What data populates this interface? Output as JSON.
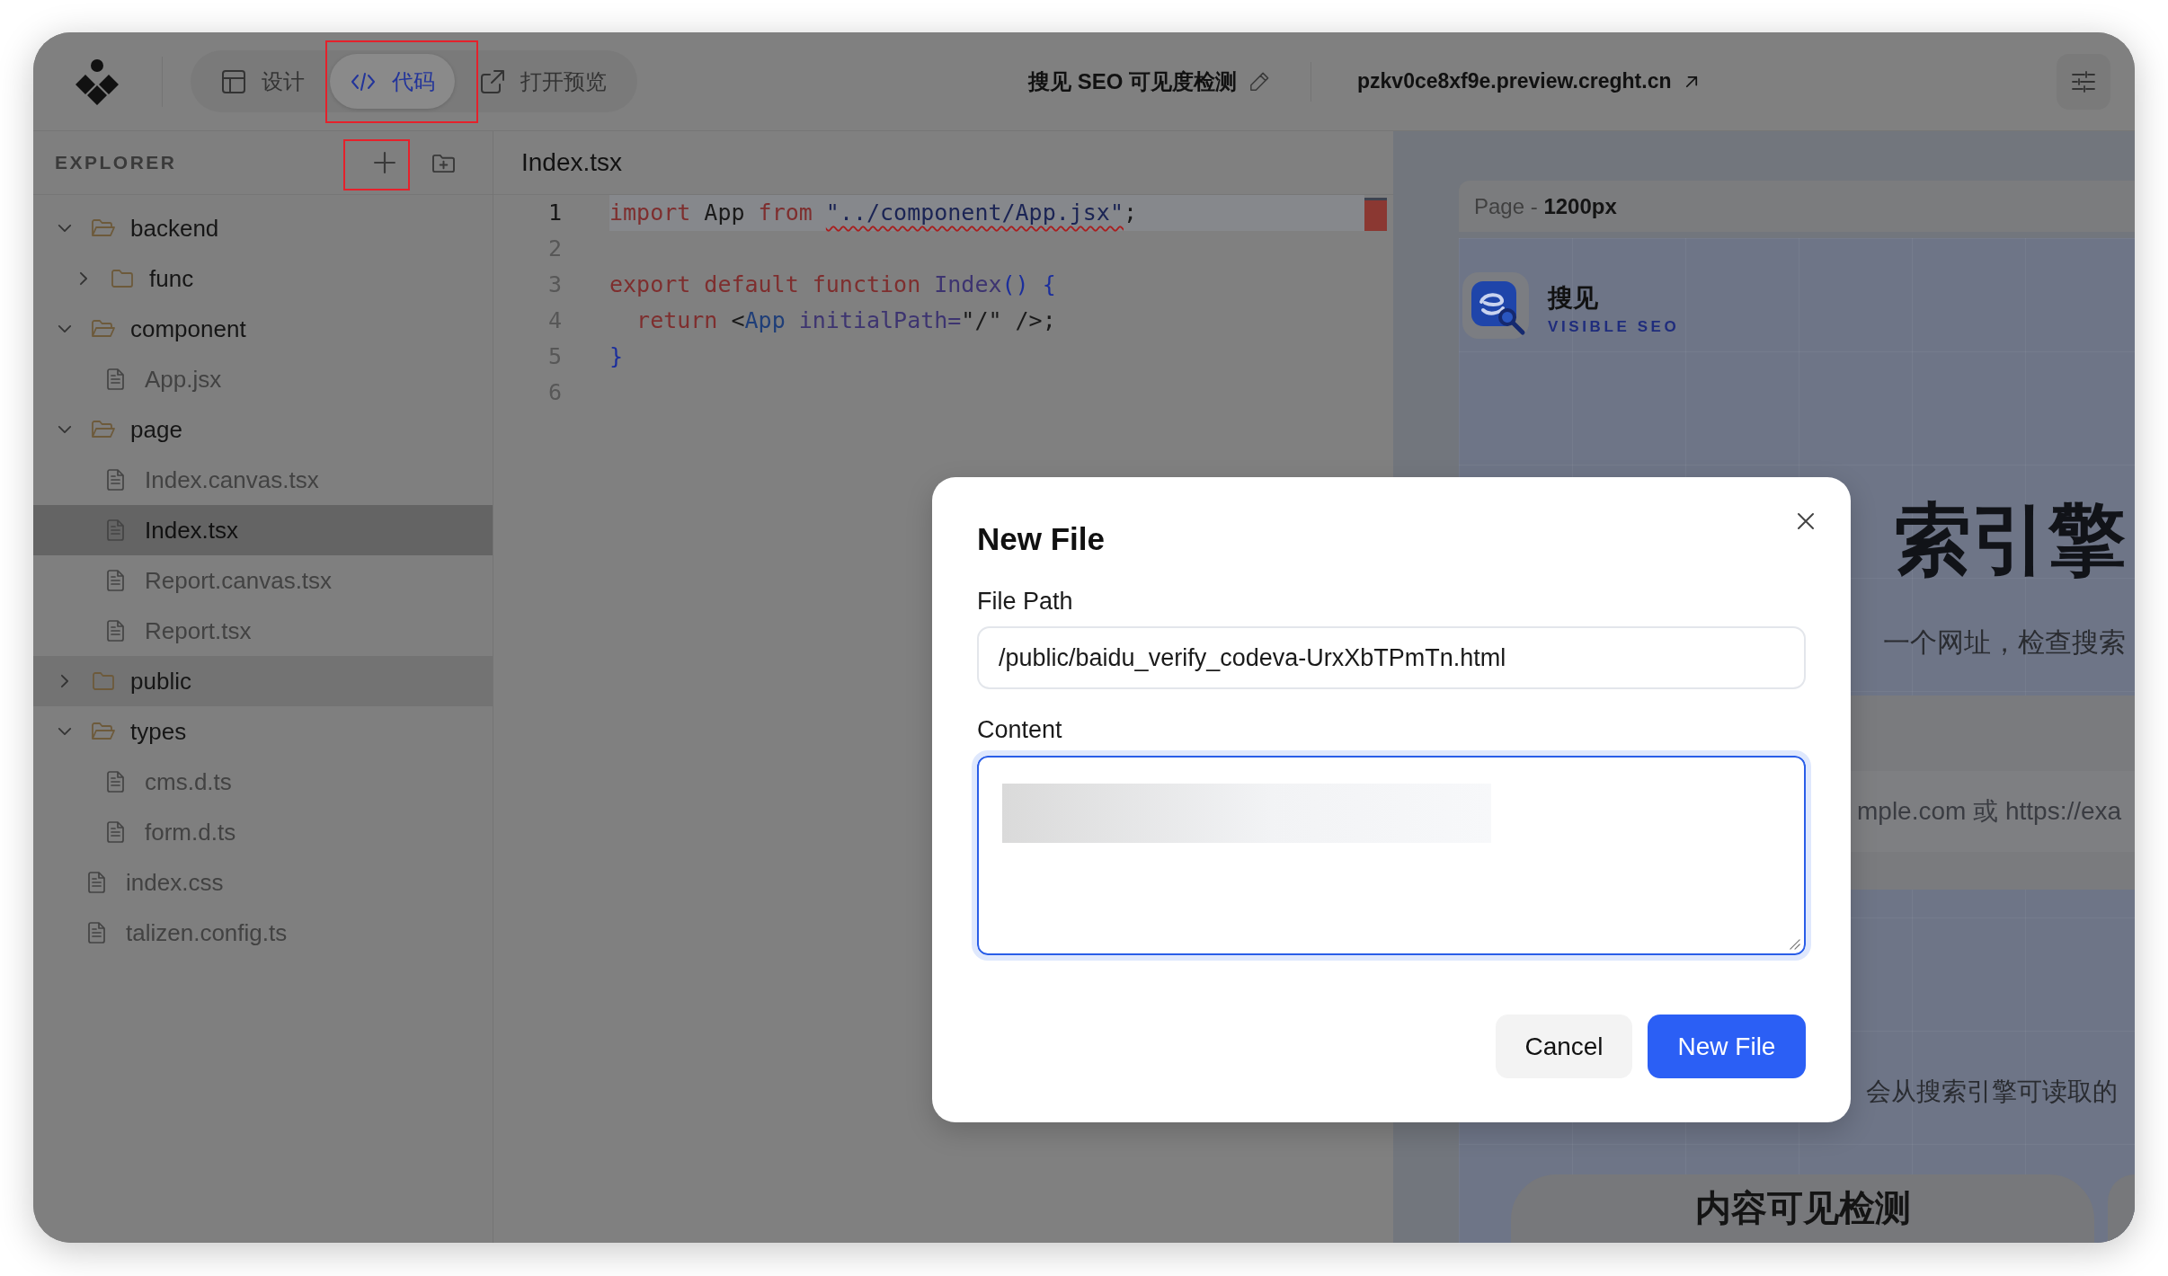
{
  "toolbar": {
    "tabs": [
      {
        "label": "设计",
        "selected": false,
        "annotated": false
      },
      {
        "label": "代码",
        "selected": true,
        "annotated": true
      },
      {
        "label": "打开预览",
        "selected": false,
        "annotated": false
      }
    ],
    "project_title": "搜见 SEO 可见度检测",
    "preview_url": "pzkv0ce8xf9e.preview.creght.cn"
  },
  "explorer": {
    "title": "EXPLORER",
    "actions": [
      {
        "annotated": true
      },
      {
        "annotated": false
      }
    ],
    "tree": [
      {
        "name": "backend",
        "kind": "folder",
        "expanded": true,
        "selected": false,
        "hovered": false,
        "children": [
          {
            "name": "func",
            "kind": "folder",
            "expanded": false,
            "selected": false,
            "hovered": false
          }
        ]
      },
      {
        "name": "component",
        "kind": "folder",
        "expanded": true,
        "selected": false,
        "hovered": false,
        "children": [
          {
            "name": "App.jsx",
            "kind": "file",
            "selected": false,
            "hovered": false
          }
        ]
      },
      {
        "name": "page",
        "kind": "folder",
        "expanded": true,
        "selected": false,
        "hovered": false,
        "children": [
          {
            "name": "Index.canvas.tsx",
            "kind": "file",
            "selected": false,
            "hovered": false
          },
          {
            "name": "Index.tsx",
            "kind": "file",
            "selected": true,
            "hovered": false
          },
          {
            "name": "Report.canvas.tsx",
            "kind": "file",
            "selected": false,
            "hovered": false
          },
          {
            "name": "Report.tsx",
            "kind": "file",
            "selected": false,
            "hovered": false
          }
        ]
      },
      {
        "name": "public",
        "kind": "folder",
        "expanded": false,
        "selected": false,
        "hovered": true
      },
      {
        "name": "types",
        "kind": "folder",
        "expanded": true,
        "selected": false,
        "hovered": false,
        "children": [
          {
            "name": "cms.d.ts",
            "kind": "file",
            "selected": false,
            "hovered": false
          },
          {
            "name": "form.d.ts",
            "kind": "file",
            "selected": false,
            "hovered": false
          }
        ]
      },
      {
        "name": "index.css",
        "kind": "file",
        "selected": false,
        "hovered": false
      },
      {
        "name": "talizen.config.ts",
        "kind": "file",
        "selected": false,
        "hovered": false
      }
    ]
  },
  "editor": {
    "file_name": "Index.tsx",
    "lines": [
      {
        "number": "1",
        "current": true,
        "tokens": [
          {
            "text": "import",
            "kind": "keyword",
            "error": false
          },
          {
            "text": " App ",
            "kind": "plain",
            "error": false
          },
          {
            "text": "from ",
            "kind": "keyword",
            "error": false
          },
          {
            "text": "\"../component/App.jsx\"",
            "kind": "string",
            "error": true
          },
          {
            "text": ";",
            "kind": "plain",
            "error": false
          }
        ]
      },
      {
        "number": "2",
        "current": false
      },
      {
        "number": "3",
        "current": false,
        "tokens": [
          {
            "text": "export default function ",
            "kind": "keyword",
            "error": false
          },
          {
            "text": "Index",
            "kind": "function",
            "error": false
          },
          {
            "text": "() {",
            "kind": "bracket",
            "error": false
          }
        ]
      },
      {
        "number": "4",
        "current": false,
        "tokens": [
          {
            "text": "  return",
            "kind": "keyword",
            "error": false
          },
          {
            "text": " <",
            "kind": "plain",
            "error": false
          },
          {
            "text": "App",
            "kind": "tag",
            "error": false
          },
          {
            "text": " initialPath=",
            "kind": "attribute",
            "error": false
          },
          {
            "text": "\"/\" />;",
            "kind": "plain",
            "error": false
          }
        ]
      },
      {
        "number": "5",
        "current": false,
        "tokens": [
          {
            "text": "}",
            "kind": "bracket",
            "error": false
          }
        ]
      },
      {
        "number": "6",
        "current": false
      }
    ]
  },
  "preview": {
    "viewport_label": "Page - **1200px**",
    "brand": "搜见",
    "tagline": "VISIBLE SEO",
    "heading": "索引擎",
    "subtitle": "一个网址，检查搜索",
    "url_placeholder": "mple.com 或 https://exa",
    "note": "会从搜索引擎可读取的",
    "card_heading": "内容可见检测"
  },
  "dialog": {
    "title": "New File",
    "fields": [
      {
        "label": "File Path",
        "kind": "input",
        "value": "/public/baidu_verify_codeva-UrxXbTPmTn.html",
        "focused": false
      },
      {
        "label": "Content",
        "kind": "textarea",
        "focused": true
      }
    ],
    "buttons": [
      {
        "label": "Cancel",
        "kind": "secondary"
      },
      {
        "label": "New File",
        "kind": "primary"
      }
    ]
  }
}
